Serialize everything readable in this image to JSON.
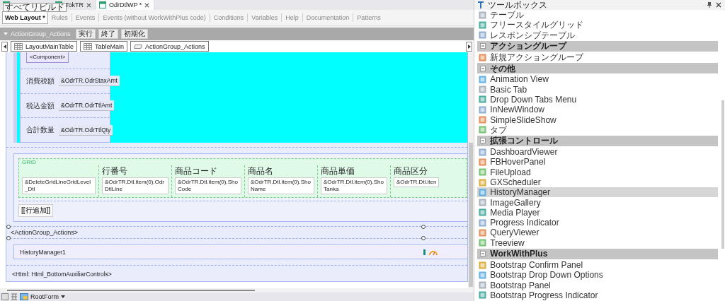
{
  "editor_tabs": [
    {
      "kind": "covered",
      "selected": false
    },
    {
      "kind": "named",
      "label": "TokTR",
      "selected": false
    },
    {
      "kind": "named",
      "label": "OdrDtlWP *",
      "selected": true
    }
  ],
  "tooltip": "すべてリビルド",
  "view_tabs": [
    {
      "label": "Web Layout *",
      "selected": true
    },
    {
      "label": "Rules",
      "selected": false
    },
    {
      "label": "Events",
      "selected": false
    },
    {
      "label": "Events (without WorkWithPlus code)",
      "selected": false
    },
    {
      "label": "Conditions",
      "selected": false
    },
    {
      "label": "Variables",
      "selected": false
    },
    {
      "label": "Help",
      "selected": false
    },
    {
      "label": "Documentation",
      "selected": false
    },
    {
      "label": "Patterns",
      "selected": false
    }
  ],
  "action_bar": {
    "title": "ActionGroup_Actions",
    "buttons": [
      "実行",
      "終了",
      "初期化"
    ]
  },
  "breadcrumb": [
    {
      "kind": "table",
      "label": "LayoutMainTable"
    },
    {
      "kind": "table",
      "label": "TableMain"
    },
    {
      "kind": "action",
      "label": "ActionGroup_Actions"
    }
  ],
  "form": {
    "component": "<Component>",
    "fields": [
      {
        "label": "消費税額",
        "value": "&OdrTR.OdrStaxAmt"
      },
      {
        "label": "税込金額",
        "value": "&OdrTR.OdrTtlAmt"
      },
      {
        "label": "合計数量",
        "value": "&OdrTR.OdrTtlQty"
      }
    ]
  },
  "grid": {
    "title": "GRID",
    "columns": [
      {
        "value": "&DeleteGridLineGridLevel_Dtl"
      },
      {
        "header": "行番号",
        "value": "&OdrTR.Dtl.item(0).OdrDtlLine"
      },
      {
        "header": "商品コード",
        "value": "&OdrTR.Dtl.item(0).ShoCode"
      },
      {
        "header": "商品名",
        "value": "&OdrTR.Dtl.item(0).ShoName"
      },
      {
        "header": "商品単価",
        "value": "&OdrTR.Dtl.item(0).ShoTanka"
      },
      {
        "header": "商品区分",
        "value": "&OdrTR.Dtl.iten"
      }
    ],
    "add_button": "[[行追加]]"
  },
  "action_group": "<ActionGroup_Actions>",
  "history_manager": "HistoryManager1",
  "html_control": "<Html: Html_BottomAuxiliarControls>",
  "status_bar": {
    "form": "RootForm"
  },
  "toolbox": {
    "title": "ツールボックス",
    "sections": [
      {
        "items": [
          {
            "label": "テーブル",
            "selected": false
          },
          {
            "label": "フリースタイルグリッド",
            "selected": false
          },
          {
            "label": "レスポンシブテーブル",
            "selected": false
          }
        ]
      },
      {
        "title": "アクショングループ",
        "expanded": true,
        "items": [
          {
            "label": "新規アクショングループ",
            "selected": false
          }
        ]
      },
      {
        "title": "その他",
        "expanded": true,
        "items": [
          {
            "label": "Animation View",
            "selected": false
          },
          {
            "label": "Basic Tab",
            "selected": false
          },
          {
            "label": "Drop Down Tabs Menu",
            "selected": false
          },
          {
            "label": "InNewWindow",
            "selected": false
          },
          {
            "label": "SimpleSlideShow",
            "selected": false
          },
          {
            "label": "タブ",
            "selected": false
          }
        ]
      },
      {
        "title": "拡張コントロール",
        "expanded": true,
        "items": [
          {
            "label": "DashboardViewer",
            "selected": false
          },
          {
            "label": "FBHoverPanel",
            "selected": false
          },
          {
            "label": "FileUpload",
            "selected": false
          },
          {
            "label": "GXScheduler",
            "selected": false
          },
          {
            "label": "HistoryManager",
            "selected": true
          },
          {
            "label": "ImageGallery",
            "selected": false
          },
          {
            "label": "Media Player",
            "selected": false
          },
          {
            "label": "Progress Indicator",
            "selected": false
          },
          {
            "label": "QueryViewer",
            "selected": false
          },
          {
            "label": "Treeview",
            "selected": false
          }
        ]
      },
      {
        "title": "WorkWithPlus",
        "expanded": true,
        "items": [
          {
            "label": "Bootstrap Confirm Panel",
            "selected": false
          },
          {
            "label": "Bootstrap Drop Down Options",
            "selected": false
          },
          {
            "label": "Bootstrap Panel",
            "selected": false
          },
          {
            "label": "Bootstrap Progress Indicator",
            "selected": false
          }
        ]
      }
    ]
  }
}
